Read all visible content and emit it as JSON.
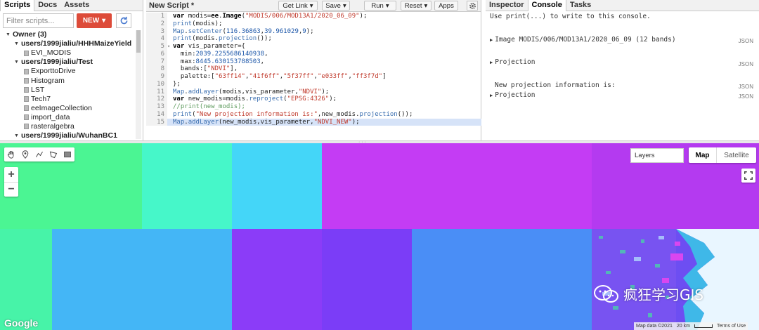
{
  "left": {
    "tabs": [
      "Scripts",
      "Docs",
      "Assets"
    ],
    "filter_placeholder": "Filter scripts...",
    "new_label": "NEW",
    "tree": [
      {
        "level": "owner",
        "expanded": true,
        "label": "Owner (3)"
      },
      {
        "level": "repo",
        "expanded": true,
        "label": "users/1999jialiu/HHHMaizeYield"
      },
      {
        "level": "file",
        "label": "EVI_MODIS"
      },
      {
        "level": "repo",
        "expanded": true,
        "label": "users/1999jialiu/Test"
      },
      {
        "level": "file",
        "label": "ExporttoDrive"
      },
      {
        "level": "file",
        "label": "Histogram"
      },
      {
        "level": "file",
        "label": "LST"
      },
      {
        "level": "file",
        "label": "Tech7"
      },
      {
        "level": "file",
        "label": "eeImageCollection"
      },
      {
        "level": "file",
        "label": "import_data"
      },
      {
        "level": "file",
        "label": "rasteralgebra"
      },
      {
        "level": "repo",
        "expanded": true,
        "label": "users/1999jialiu/WuhanBC1"
      }
    ]
  },
  "editor": {
    "title": "New Script *",
    "buttons": {
      "get_link": "Get Link",
      "save": "Save",
      "run": "Run",
      "reset": "Reset",
      "apps": "Apps"
    },
    "highlight_line": 15,
    "lines": [
      [
        [
          "kw",
          "var "
        ],
        [
          "txt",
          "modis="
        ],
        [
          "kw",
          "ee"
        ],
        [
          "txt",
          "."
        ],
        [
          "kw",
          "Image"
        ],
        [
          "txt",
          "("
        ],
        [
          "str",
          "\"MODIS/006/MOD13A1/2020_06_09\""
        ],
        [
          "txt",
          ");"
        ]
      ],
      [
        [
          "prop",
          "print"
        ],
        [
          "txt",
          "(modis);"
        ]
      ],
      [
        [
          "prop",
          "Map"
        ],
        [
          "txt",
          "."
        ],
        [
          "prop",
          "setCenter"
        ],
        [
          "txt",
          "("
        ],
        [
          "num",
          "116.36863"
        ],
        [
          "txt",
          ","
        ],
        [
          "num",
          "39.961029"
        ],
        [
          "txt",
          ","
        ],
        [
          "num",
          "9"
        ],
        [
          "txt",
          ");"
        ]
      ],
      [
        [
          "prop",
          "print"
        ],
        [
          "txt",
          "(modis."
        ],
        [
          "prop",
          "projection"
        ],
        [
          "txt",
          "());"
        ]
      ],
      [
        [
          "kw",
          "var "
        ],
        [
          "txt",
          "vis_parameter={"
        ]
      ],
      [
        [
          "txt",
          "  min:"
        ],
        [
          "num",
          "2039.2255686140938"
        ],
        [
          "txt",
          ","
        ]
      ],
      [
        [
          "txt",
          "  max:"
        ],
        [
          "num",
          "8445.630153788503"
        ],
        [
          "txt",
          ","
        ]
      ],
      [
        [
          "txt",
          "  bands:["
        ],
        [
          "str",
          "\"NDVI\""
        ],
        [
          "txt",
          "],"
        ]
      ],
      [
        [
          "txt",
          "  palette:["
        ],
        [
          "str",
          "\"63ff14\""
        ],
        [
          "txt",
          ","
        ],
        [
          "str",
          "\"41f6ff\""
        ],
        [
          "txt",
          ","
        ],
        [
          "str",
          "\"5f37ff\""
        ],
        [
          "txt",
          ","
        ],
        [
          "str",
          "\"e033ff\""
        ],
        [
          "txt",
          ","
        ],
        [
          "str",
          "\"ff3f7d\""
        ],
        [
          "txt",
          "]"
        ]
      ],
      [
        [
          "txt",
          "};"
        ]
      ],
      [
        [
          "prop",
          "Map"
        ],
        [
          "txt",
          "."
        ],
        [
          "prop",
          "addLayer"
        ],
        [
          "txt",
          "(modis,vis_parameter,"
        ],
        [
          "str",
          "\"NDVI\""
        ],
        [
          "txt",
          ");"
        ]
      ],
      [
        [
          "kw",
          "var "
        ],
        [
          "txt",
          "new_modis=modis."
        ],
        [
          "prop",
          "reproject"
        ],
        [
          "txt",
          "("
        ],
        [
          "str",
          "\"EPSG:4326\""
        ],
        [
          "txt",
          ");"
        ]
      ],
      [
        [
          "cmt",
          "//print(new_modis);"
        ]
      ],
      [
        [
          "prop",
          "print"
        ],
        [
          "txt",
          "("
        ],
        [
          "str",
          "\"New projection information is:\""
        ],
        [
          "txt",
          ",new_modis."
        ],
        [
          "prop",
          "projection"
        ],
        [
          "txt",
          "());"
        ]
      ],
      [
        [
          "prop",
          "Map"
        ],
        [
          "txt",
          "."
        ],
        [
          "prop",
          "addLayer"
        ],
        [
          "txt",
          "(new_modis,vis_parameter,"
        ],
        [
          "str",
          "\"NDVI_NEW\""
        ],
        [
          "txt",
          ");"
        ]
      ]
    ]
  },
  "right": {
    "tabs": [
      "Inspector",
      "Console",
      "Tasks"
    ],
    "hint": "Use print(...) to write to this console.",
    "json_label": "JSON",
    "entries": {
      "image": "Image MODIS/006/MOD13A1/2020_06_09 (12 bands)",
      "projection1": "Projection",
      "new_proj_text": "New projection information is:",
      "projection2": "Projection"
    }
  },
  "map": {
    "layers_label": "Layers",
    "map_label": "Map",
    "satellite_label": "Satellite",
    "zoom_in": "+",
    "zoom_out": "−",
    "google": "Google",
    "attribution": {
      "map_data": "Map data ©2021",
      "scale": "20 km",
      "terms": "Terms of Use"
    },
    "watermark": "疯狂学习GIS"
  },
  "colors": {
    "new_button": "#dd4b39",
    "highlight": "#d6e3f8"
  }
}
